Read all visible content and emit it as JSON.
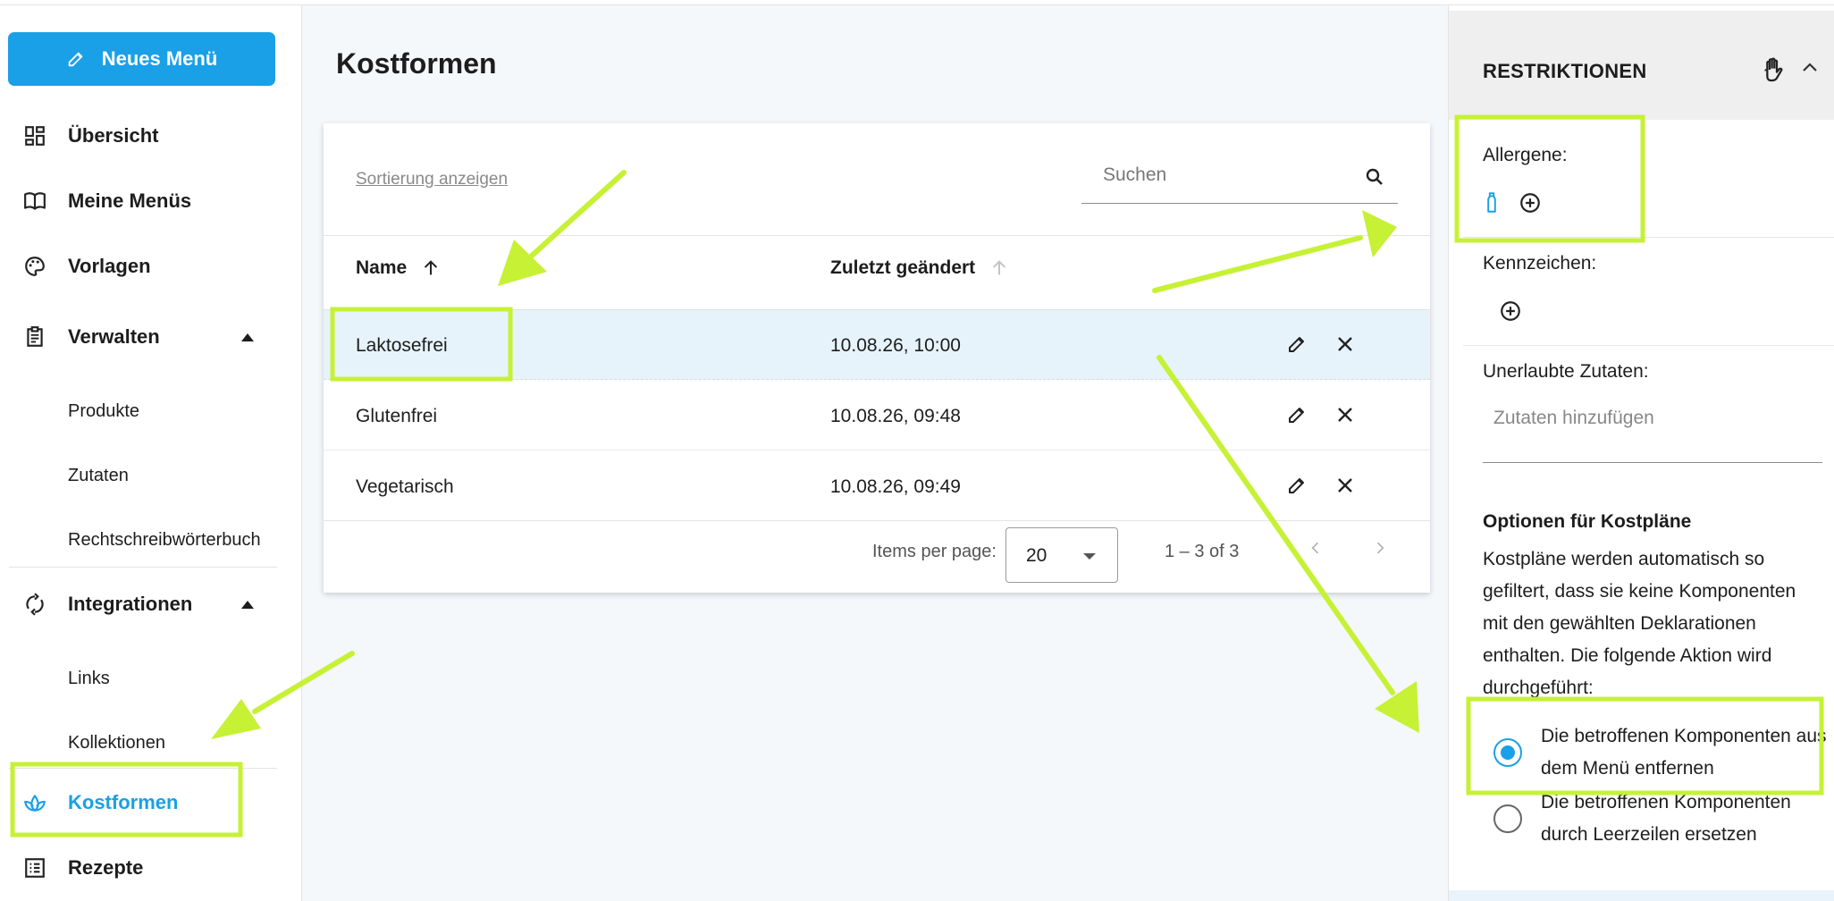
{
  "sidebar": {
    "new_menu_label": "Neues Menü",
    "items": {
      "uebersicht": "Übersicht",
      "meine_menus": "Meine Menüs",
      "vorlagen": "Vorlagen",
      "verwalten": "Verwalten",
      "produkte": "Produkte",
      "zutaten": "Zutaten",
      "woerterbuch": "Rechtschreibwörterbuch",
      "integrationen": "Integrationen",
      "links": "Links",
      "kollektionen": "Kollektionen",
      "kostformen": "Kostformen",
      "rezepte": "Rezepte"
    },
    "accent_color": "#1aa0e6"
  },
  "main": {
    "title": "Kostformen",
    "sort_link": "Sortierung anzeigen",
    "search_placeholder": "Suchen",
    "columns": {
      "name": "Name",
      "changed": "Zuletzt geändert"
    },
    "rows": [
      {
        "name": "Laktosefrei",
        "changed": "10.08.26, 10:00",
        "selected": true
      },
      {
        "name": "Glutenfrei",
        "changed": "10.08.26, 09:48",
        "selected": false
      },
      {
        "name": "Vegetarisch",
        "changed": "10.08.26, 09:49",
        "selected": false
      }
    ],
    "pagination": {
      "items_per_page_label": "Items per page:",
      "page_size": "20",
      "range": "1 – 3 of 3"
    }
  },
  "restrictions": {
    "title": "RESTRIKTIONEN",
    "allergene_label": "Allergene:",
    "kennzeichen_label": "Kennzeichen:",
    "unerlaubte_label": "Unerlaubte Zutaten:",
    "zutaten_placeholder": "Zutaten hinzufügen",
    "options_title": "Optionen für Kostpläne",
    "options_text": "Kostpläne werden automatisch so gefiltert, dass sie keine Komponenten mit den gewählten Deklarationen enthalten. Die folgende Aktion wird durchgeführt:",
    "radio_options": [
      {
        "label": "Die betroffenen Komponenten aus dem Menü entfernen",
        "selected": true
      },
      {
        "label": "Die betroffenen Komponenten durch Leerzeilen ersetzen",
        "selected": false
      }
    ]
  },
  "annotation_color": "#c6f135"
}
